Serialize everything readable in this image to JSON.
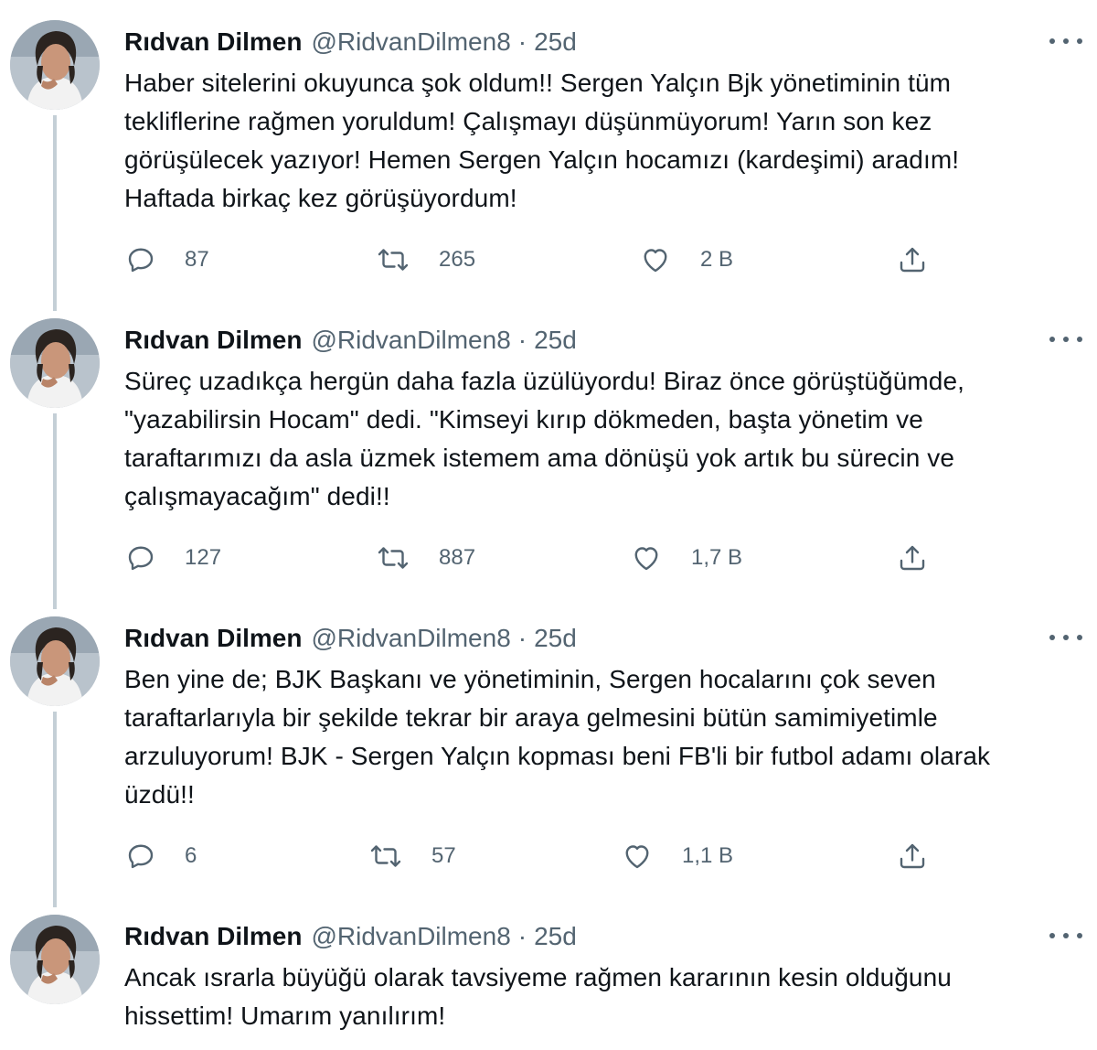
{
  "colors": {
    "text": "#0f1419",
    "secondary": "#536471",
    "thread_line": "#c4cfd6",
    "background": "#ffffff"
  },
  "icons": {
    "reply": "reply-icon",
    "retweet": "retweet-icon",
    "like": "heart-icon",
    "share": "share-icon",
    "more": "more-options-icon"
  },
  "tweets": [
    {
      "author": "Rıdvan Dilmen",
      "handle": "@RidvanDilmen8",
      "dot": "·",
      "time": "25d",
      "lines": [
        "Haber sitelerini okuyunca şok oldum!! Sergen Yalçın Bjk yönetiminin tüm",
        "tekliflerine rağmen yoruldum! Çalışmayı düşünmüyorum! Yarın son kez",
        "görüşülecek yazıyor! Hemen Sergen Yalçın hocamızı (kardeşimi) aradım!",
        "Haftada birkaç kez görüşüyordum!"
      ],
      "replies": "87",
      "retweets": "265",
      "likes": "2 B"
    },
    {
      "author": "Rıdvan Dilmen",
      "handle": "@RidvanDilmen8",
      "dot": "·",
      "time": "25d",
      "lines": [
        "Süreç uzadıkça hergün daha fazla üzülüyordu! Biraz önce görüştüğümde,",
        "\"yazabilirsin Hocam\" dedi. \"Kimseyi kırıp dökmeden, başta yönetim ve",
        "taraftarımızı da asla üzmek istemem ama dönüşü yok artık bu sürecin ve",
        "çalışmayacağım\" dedi!!"
      ],
      "replies": "127",
      "retweets": "887",
      "likes": "1,7 B"
    },
    {
      "author": "Rıdvan Dilmen",
      "handle": "@RidvanDilmen8",
      "dot": "·",
      "time": "25d",
      "lines": [
        "Ben yine de; BJK Başkanı ve yönetiminin, Sergen hocalarını çok seven",
        "taraftarlarıyla bir şekilde tekrar bir araya gelmesini bütün samimiyetimle",
        "arzuluyorum! BJK - Sergen Yalçın kopması beni FB'li bir futbol adamı olarak",
        "üzdü!!"
      ],
      "replies": "6",
      "retweets": "57",
      "likes": "1,1 B"
    },
    {
      "author": "Rıdvan Dilmen",
      "handle": "@RidvanDilmen8",
      "dot": "·",
      "time": "25d",
      "lines": [
        "Ancak ısrarla büyüğü olarak tavsiyeme rağmen kararının kesin olduğunu",
        "hissettim! Umarım yanılırım!"
      ]
    }
  ]
}
